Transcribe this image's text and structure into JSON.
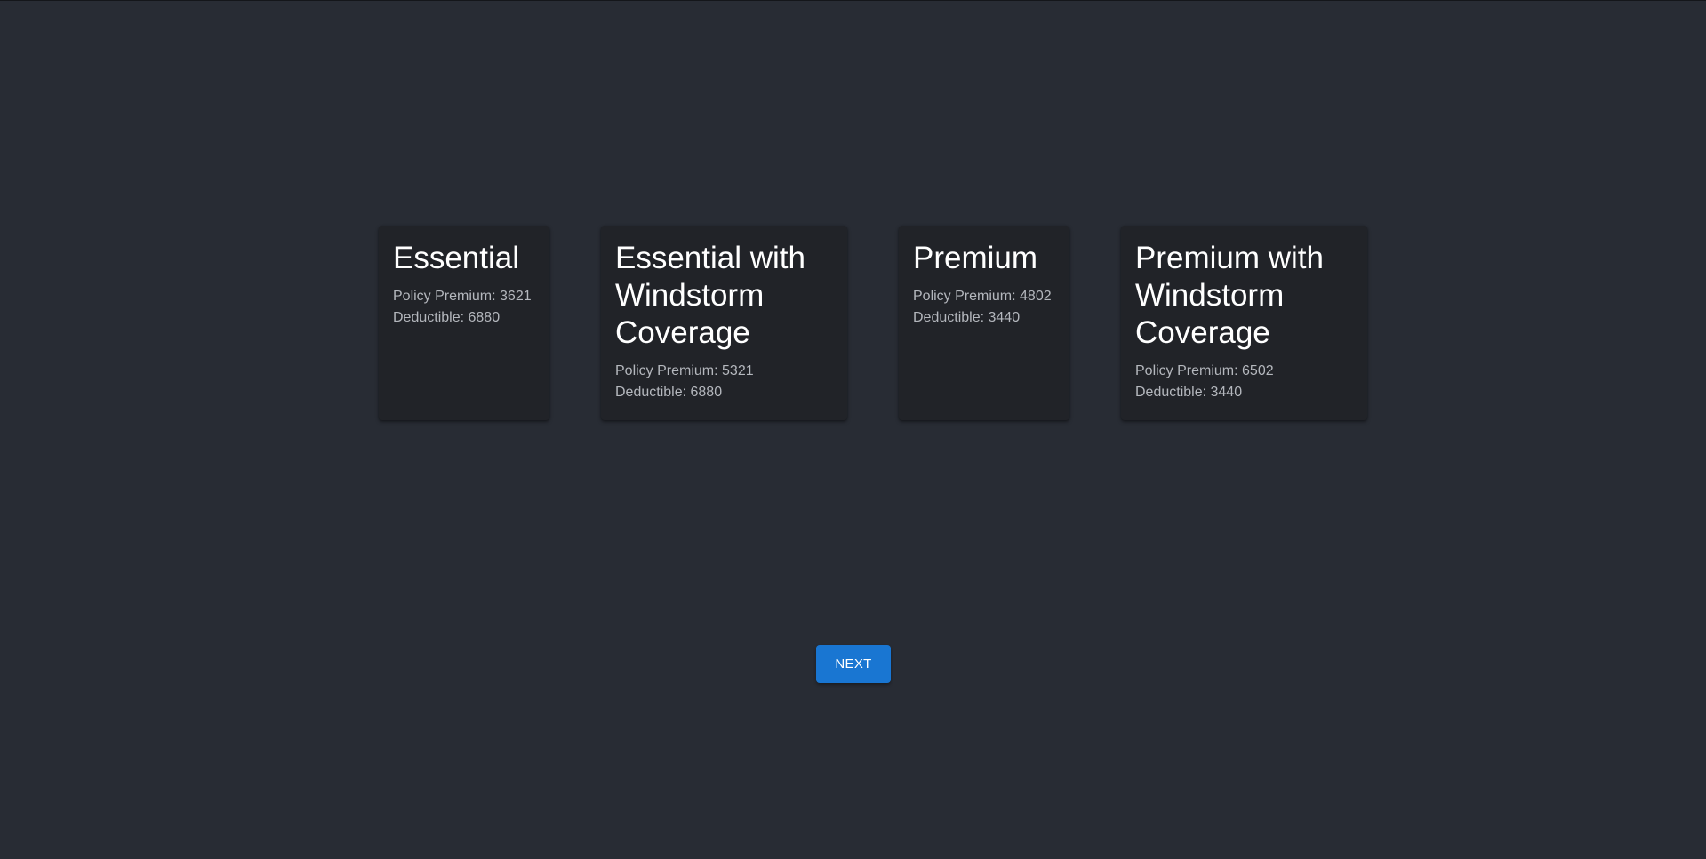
{
  "plans": [
    {
      "title": "Essential",
      "premium_text": "Policy Premium: 3621",
      "deductible_text": "Deductible: 6880"
    },
    {
      "title": "Essential with Windstorm Coverage",
      "premium_text": "Policy Premium: 5321",
      "deductible_text": "Deductible: 6880"
    },
    {
      "title": "Premium",
      "premium_text": "Policy Premium: 4802",
      "deductible_text": "Deductible: 3440"
    },
    {
      "title": "Premium with Windstorm Coverage",
      "premium_text": "Policy Premium: 6502",
      "deductible_text": "Deductible: 3440"
    }
  ],
  "next_button": {
    "label": "NEXT"
  },
  "colors": {
    "background": "#282c34",
    "card": "#212328",
    "accent": "#1976d2"
  }
}
